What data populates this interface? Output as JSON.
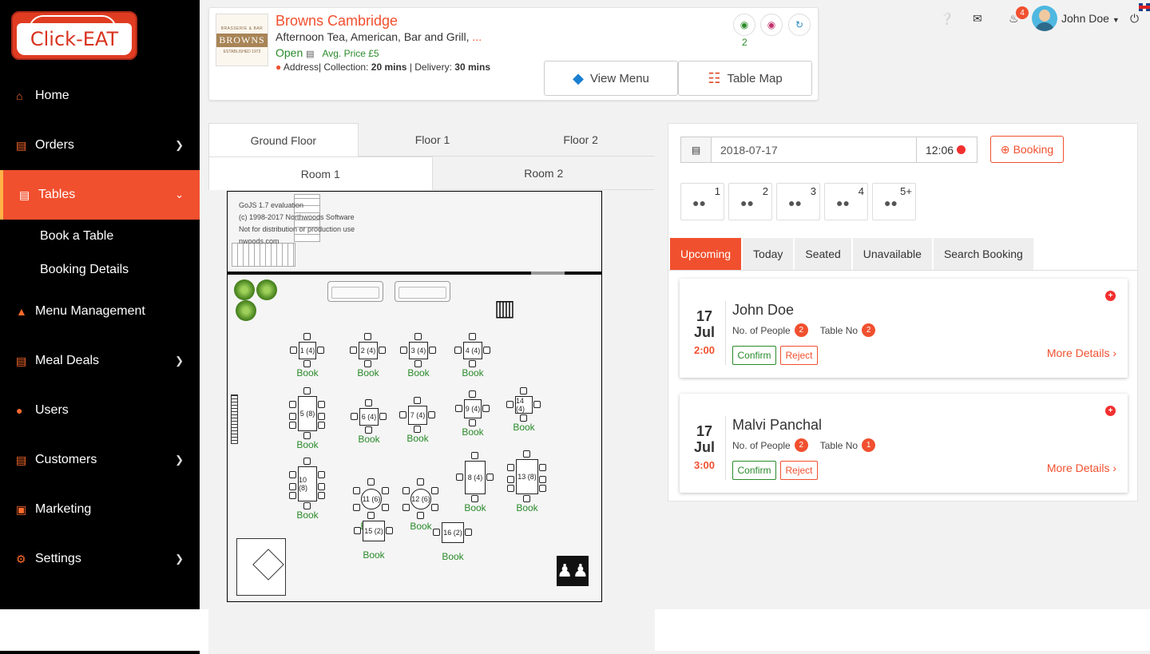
{
  "brand": {
    "name": "Click-EAT"
  },
  "sidebar": {
    "items": [
      {
        "label": "Home"
      },
      {
        "label": "Orders"
      },
      {
        "label": "Tables"
      },
      {
        "label": "Menu Management"
      },
      {
        "label": "Meal Deals"
      },
      {
        "label": "Users"
      },
      {
        "label": "Customers"
      },
      {
        "label": "Marketing"
      },
      {
        "label": "Settings"
      }
    ],
    "sub_items": [
      {
        "label": "Book a Table"
      },
      {
        "label": "Booking Details"
      }
    ]
  },
  "restaurant": {
    "logo_top": "BRASSERIE & BAR",
    "logo_name": "BROWNS",
    "logo_bottom": "ESTABLISHED 1973",
    "name": "Browns Cambridge",
    "cuisine": "Afternoon Tea, American, Bar and Grill,",
    "cuisine_more": "...",
    "status": "Open",
    "avg_price": "Avg. Price £5",
    "address_label": "Address| Collection:",
    "collection_time": "20 mins",
    "delivery_label": "| Delivery:",
    "delivery_time": "30 mins",
    "chat_count": "2",
    "view_menu_label": "View Menu",
    "table_map_label": "Table Map"
  },
  "topbar": {
    "notification_count": "4",
    "user_name": "John Doe",
    "icons": [
      "help-icon",
      "mail-icon",
      "bell-icon",
      "power-icon"
    ]
  },
  "floor_tabs": [
    "Ground Floor",
    "Floor 1",
    "Floor 2"
  ],
  "room_tabs": [
    "Room 1",
    "Room 2"
  ],
  "floorplan": {
    "watermark": [
      "GoJS 1.7 evaluation",
      "(c) 1998-2017 Northwoods Software",
      "Not for distribution or production use",
      "nwoods.com"
    ],
    "book_label": "Book",
    "tables": [
      {
        "label": "1 (4)"
      },
      {
        "label": "2 (4)"
      },
      {
        "label": "3 (4)"
      },
      {
        "label": "4 (4)"
      },
      {
        "label": "5 (8)"
      },
      {
        "label": "6 (4)"
      },
      {
        "label": "7 (4)"
      },
      {
        "label": "9 (4)"
      },
      {
        "label": "14 (4)"
      },
      {
        "label": "10 (8)"
      },
      {
        "label": "11 (6)"
      },
      {
        "label": "12 (6)"
      },
      {
        "label": "8 (4)"
      },
      {
        "label": "13 (8)"
      },
      {
        "label": "15 (2)"
      },
      {
        "label": "16 (2)"
      }
    ]
  },
  "booking": {
    "date": "2018-07-17",
    "time": "12:06",
    "booking_button": "Booking",
    "people_options": [
      "1",
      "2",
      "3",
      "4",
      "5+"
    ],
    "status_tabs": [
      "Upcoming",
      "Today",
      "Seated",
      "Unavailable",
      "Search Booking"
    ],
    "people_label": "No. of People",
    "table_label": "Table No",
    "confirm_label": "Confirm",
    "reject_label": "Reject",
    "more_label": "More Details ›",
    "cards": [
      {
        "day": "17",
        "month": "Jul",
        "time": "2:00",
        "name": "John Doe",
        "people": "2",
        "table": "2"
      },
      {
        "day": "17",
        "month": "Jul",
        "time": "3:00",
        "name": "Malvi Panchal",
        "people": "2",
        "table": "1"
      }
    ]
  },
  "colors": {
    "accent": "#f1502f",
    "sidebar": "#000000",
    "success": "#2a8a2a"
  }
}
